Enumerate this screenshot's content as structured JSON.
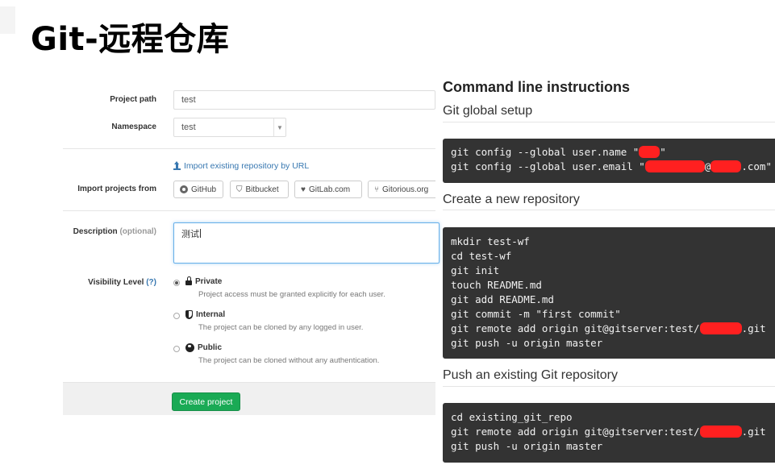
{
  "slide": {
    "title": "Git-远程仓库"
  },
  "form": {
    "project_path": {
      "label": "Project path",
      "value": "test"
    },
    "namespace": {
      "label": "Namespace",
      "value": "test"
    },
    "import": {
      "link_label": "Import existing repository by URL",
      "label": "Import projects from",
      "sources": [
        "GitHub",
        "Bitbucket",
        "GitLab.com",
        "Gitorious.org"
      ]
    },
    "description": {
      "label": "Description",
      "optional": "(optional)",
      "value": "测试"
    },
    "visibility": {
      "label": "Visibility Level",
      "help": "(?)",
      "options": [
        {
          "name": "Private",
          "desc": "Project access must be granted explicitly for each user.",
          "icon": "lock-icon",
          "selected": true
        },
        {
          "name": "Internal",
          "desc": "The project can be cloned by any logged in user.",
          "icon": "shield-icon",
          "selected": false
        },
        {
          "name": "Public",
          "desc": "The project can be cloned without any authentication.",
          "icon": "globe-icon",
          "selected": false
        }
      ]
    },
    "create_button": "Create project",
    "colors": {
      "primary": "#1aaa55",
      "link": "#3777b0",
      "focus": "#66afe9"
    }
  },
  "cli": {
    "title": "Command line instructions",
    "global_setup": {
      "heading": "Git global setup",
      "lines": {
        "name_prefix": "git config --global user.name \"",
        "name_suffix": "\"",
        "email_prefix": "git config --global user.email \"",
        "email_at": "@",
        "email_suffix": ".com\""
      }
    },
    "new_repo": {
      "heading": "Create a new repository",
      "lines": [
        "mkdir test-wf",
        "cd test-wf",
        "git init",
        "touch README.md",
        "git add README.md",
        "git commit -m \"first commit\""
      ],
      "remote_prefix": "git remote add origin git@gitserver:test/",
      "remote_suffix": ".git",
      "push": "git push -u origin master"
    },
    "existing_repo": {
      "heading": "Push an existing Git repository",
      "cd": "cd existing_git_repo",
      "remote_prefix": "git remote add origin git@gitserver:test/",
      "remote_suffix": ".git",
      "push": "git push -u origin master"
    },
    "colors": {
      "code_bg": "#333333",
      "redaction": "#ff2020"
    }
  }
}
